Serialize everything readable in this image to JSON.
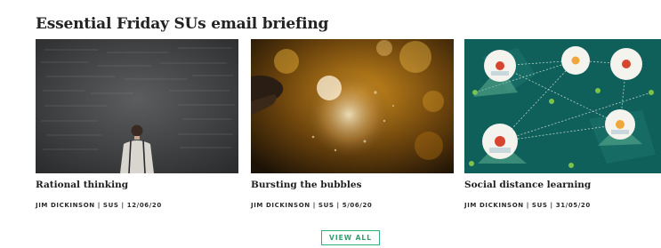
{
  "section": {
    "title": "Essential Friday SUs email briefing"
  },
  "cards": [
    {
      "title": "Rational thinking",
      "meta": "JIM DICKINSON | SUS | 12/06/20",
      "image": "man-at-chalkboard-image"
    },
    {
      "title": "Bursting the bubbles",
      "meta": "JIM DICKINSON | SUS | 5/06/20",
      "image": "hand-bursting-bubble-image"
    },
    {
      "title": "Social distance learning",
      "meta": "JIM DICKINSON | SUS | 31/05/20",
      "image": "network-people-illustration"
    }
  ],
  "view_all": {
    "label": "VIEW ALL"
  },
  "colors": {
    "accent": "#33b07a",
    "teal_bg": "#0f5f5a"
  }
}
